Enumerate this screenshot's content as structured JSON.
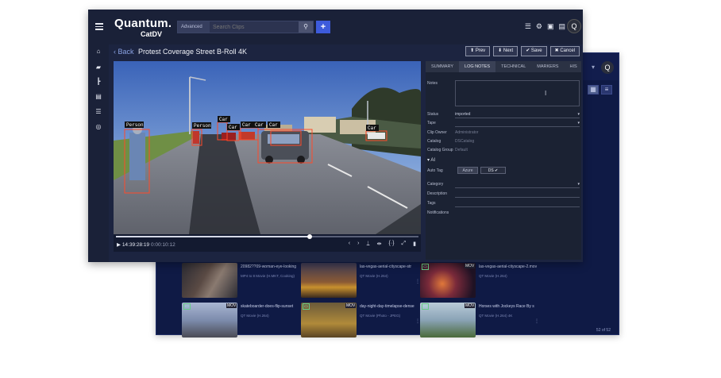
{
  "app": {
    "logo_main": "Quantum.",
    "logo_sub": "CatDV",
    "search_placeholder": "Search Clips",
    "advanced_label": "Advanced",
    "add_label": "+",
    "avatar_initial": "Q"
  },
  "clip": {
    "back_label": "Back",
    "title": "Protest Coverage Street B-Roll 4K",
    "buttons": {
      "prev": "Prev",
      "next": "Next",
      "save": "Save",
      "cancel": "Cancel"
    },
    "timecode": "14:39:28:19",
    "duration": "0:00:10:12",
    "progress": 0.64
  },
  "detections": [
    {
      "label": "Person"
    },
    {
      "label": "Person"
    },
    {
      "label": "Car"
    },
    {
      "label": "Car"
    },
    {
      "label": "Car"
    },
    {
      "label": "Car"
    },
    {
      "label": "Car"
    },
    {
      "label": "Car"
    }
  ],
  "metadata": {
    "tabs": [
      "SUMMARY",
      "LOG NOTES",
      "TECHNICAL",
      "MARKERS",
      "HIS"
    ],
    "active_tab": 1,
    "fields": {
      "notes_label": "Notes",
      "status_label": "Status",
      "status_value": "imported",
      "tape_label": "Tape",
      "owner_label": "Clip Owner",
      "owner_value": "Administrator",
      "catalog_label": "Catalog",
      "catalog_value": "DSCatalog",
      "group_label": "Catalog Group",
      "group_value": "Default",
      "ai_label": "AI",
      "autotag_label": "Auto Tag",
      "autotag_off": "Azure",
      "autotag_on": "DS",
      "category_label": "Category",
      "description_label": "Description",
      "tags_label": "Tags",
      "notifications_label": "Notifications"
    }
  },
  "browser": {
    "count": "52 of 52",
    "thumbs": [
      {
        "title": "20982??09-woman-eye-looking",
        "sub": "MP4 to 8 Movie (H.MKT, Cooking)",
        "format": "",
        "color": "#3a3a44"
      },
      {
        "title": "las-vegas-aerial-cityscape-str",
        "sub": "QT Movie (H.264)",
        "format": "",
        "color": "#6a4a2c"
      },
      {
        "title": "las-vegas-aerial-cityscape-2.mov",
        "sub": "QT Movie (H.264)",
        "format": "MOV",
        "color": "#3a2434"
      },
      {
        "title": "skateboarder-does-flip-sunset",
        "sub": "QT Movie (H.264)",
        "format": "MOV",
        "color": "#7a8ab0"
      },
      {
        "title": "day-night-day-timelapse-dense",
        "sub": "QT Movie (Photo - JPEG)",
        "format": "MOV",
        "color": "#8a6a2a"
      },
      {
        "title": "Horses with Jockeys Race By s",
        "sub": "QT Movie (H.264) 4K",
        "format": "MOV",
        "color": "#8aa3b6"
      }
    ]
  }
}
